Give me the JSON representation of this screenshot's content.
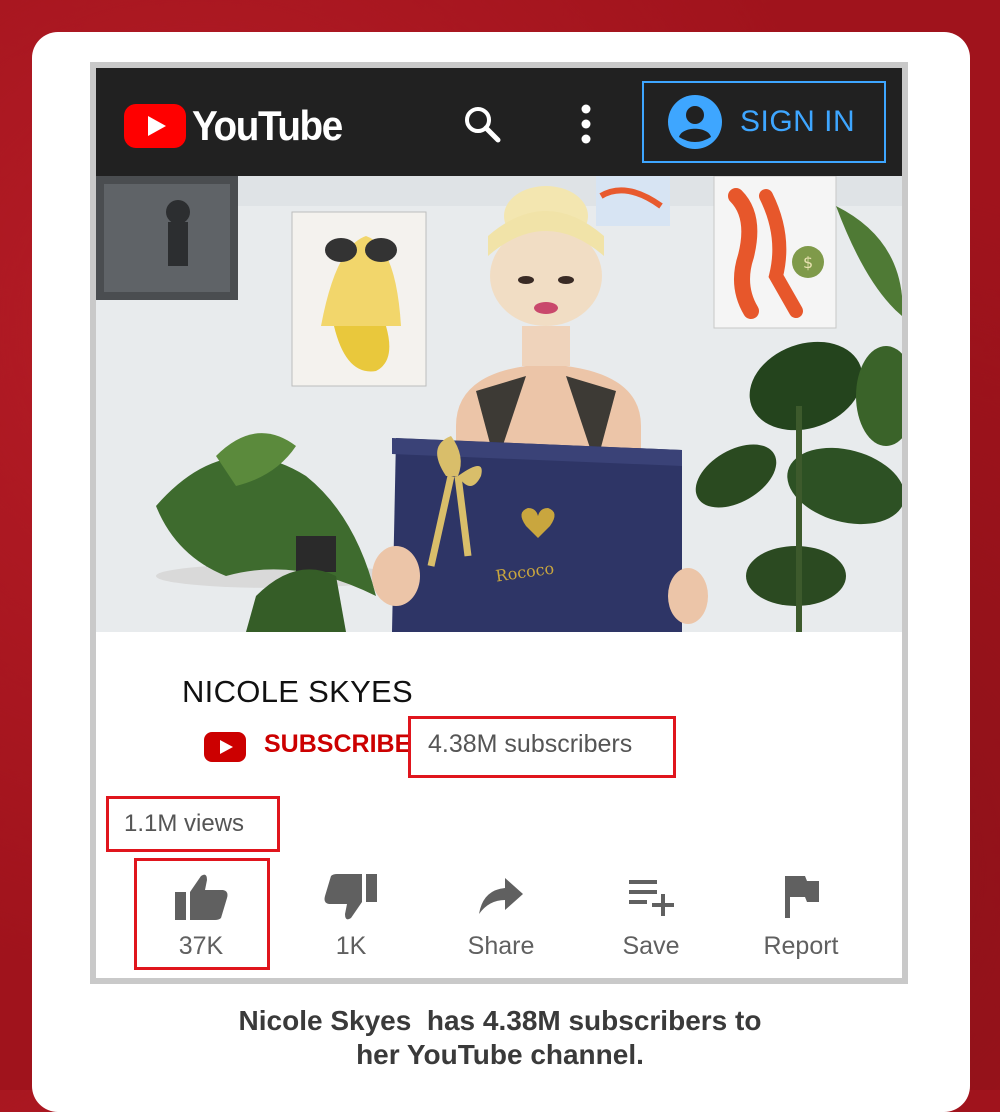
{
  "header": {
    "logo_text": "YouTube",
    "sign_in_label": "SIGN IN"
  },
  "channel": {
    "name": "NICOLE SKYES",
    "subscribe_label": "SUBSCRIBE",
    "subscribers": "4.38M subscribers"
  },
  "video": {
    "views": "1.1M views"
  },
  "actions": [
    {
      "label": "37K",
      "icon": "thumbs-up-icon"
    },
    {
      "label": "1K",
      "icon": "thumbs-down-icon"
    },
    {
      "label": "Share",
      "icon": "share-icon"
    },
    {
      "label": "Save",
      "icon": "playlist-add-icon"
    },
    {
      "label": "Report",
      "icon": "flag-icon"
    }
  ],
  "caption": {
    "line1": "Nicole Skyes  has 4.38M subscribers to",
    "line2": "her YouTube channel."
  },
  "colors": {
    "background": "#a0131c",
    "youtube_red": "#ff0000",
    "sign_in_blue": "#3ea6ff",
    "highlight_red": "#e0151d"
  }
}
